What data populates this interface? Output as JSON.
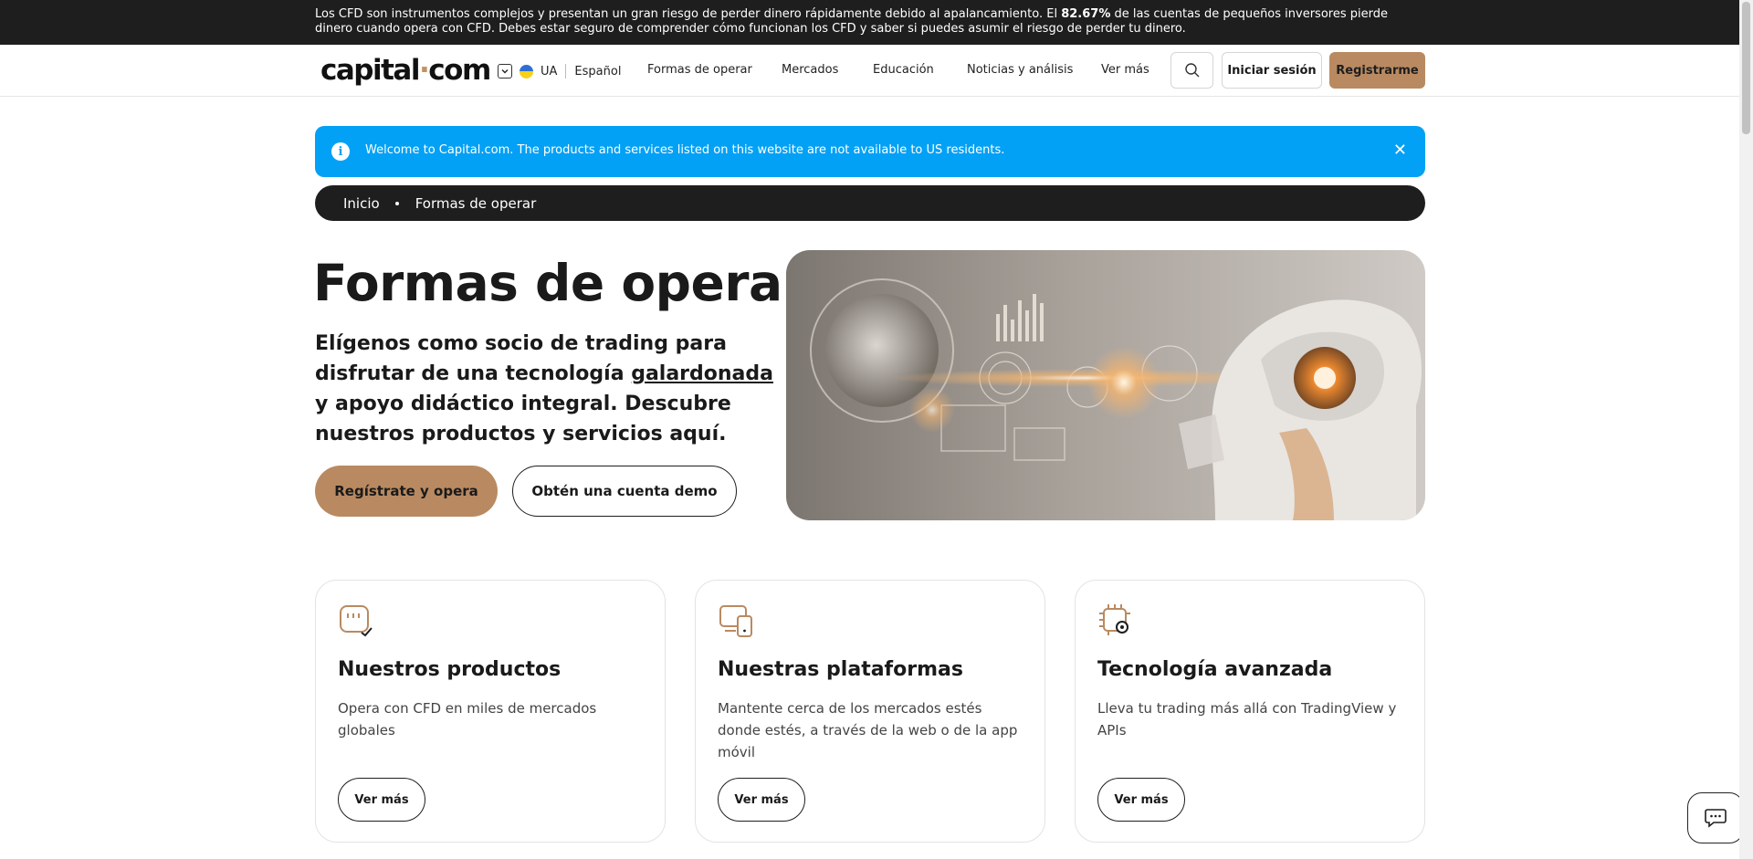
{
  "risk_banner": {
    "text_before": "Los CFD son instrumentos complejos y presentan un gran riesgo de perder dinero rápidamente debido al apalancamiento. El ",
    "percent": "82.67%",
    "text_after": " de las cuentas de pequeños inversores pierde dinero cuando opera con CFD. Debes estar seguro de comprender cómo funcionan los CFD y saber si puedes asumir el riesgo de perder tu dinero."
  },
  "header": {
    "logo_main": "capital",
    "logo_dot": "·",
    "logo_end": "com",
    "region": "UA",
    "language": "Español",
    "nav": [
      "Formas de operar",
      "Mercados",
      "Educación",
      "Noticias y análisis",
      "Ver más"
    ],
    "login_label": "Iniciar sesión",
    "register_label": "Registrarme"
  },
  "notice": {
    "icon": "i",
    "text": "Welcome to Capital.com. The products and services listed on this website are not available to US residents.",
    "close": "✕"
  },
  "breadcrumb": {
    "home": "Inicio",
    "current": "Formas de operar"
  },
  "hero": {
    "title": "Formas de operar",
    "subtitle_before": "Elígenos como socio de trading para disfrutar de una tecnología ",
    "subtitle_link": "galardonada",
    "subtitle_after": " y apoyo didáctico integral. Descubre nuestros productos y servicios aquí.",
    "cta_primary": "Regístrate y opera",
    "cta_secondary": "Obtén una cuenta demo"
  },
  "cards": [
    {
      "icon": "chat-check-icon",
      "title": "Nuestros productos",
      "desc": "Opera con CFD en miles de mercados globales",
      "button": "Ver más"
    },
    {
      "icon": "devices-icon",
      "title": "Nuestras plataformas",
      "desc": "Mantente cerca de los mercados estés donde estés, a través de la web o de la app móvil",
      "button": "Ver más"
    },
    {
      "icon": "chip-gear-icon",
      "title": "Tecnología avanzada",
      "desc": "Lleva tu trading más allá con TradingView y APIs",
      "button": "Ver más"
    }
  ],
  "colors": {
    "accent": "#b98a61",
    "notice": "#02a1f5",
    "dark": "#1e1e1e"
  }
}
